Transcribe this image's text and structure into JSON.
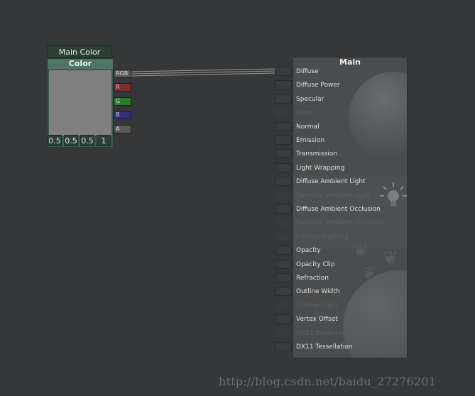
{
  "color_node": {
    "title": "Main Color",
    "header": "Color",
    "swatch_color": "#808080",
    "values": [
      "0.5",
      "0.5",
      "0.5",
      "1"
    ],
    "outputs": [
      {
        "label": "RGB",
        "color": "#5a5a5a"
      },
      {
        "label": "R",
        "color": "#7a2f2f"
      },
      {
        "label": "G",
        "color": "#2f7a32"
      },
      {
        "label": "B",
        "color": "#2f2f7a"
      },
      {
        "label": "A",
        "color": "#5a5a5a"
      }
    ]
  },
  "main_node": {
    "title": "Main",
    "inputs": [
      {
        "label": "Diffuse",
        "enabled": true
      },
      {
        "label": "Diffuse Power",
        "enabled": true
      },
      {
        "label": "Specular",
        "enabled": true
      },
      {
        "label": "Gloss",
        "enabled": false
      },
      {
        "label": "Normal",
        "enabled": true
      },
      {
        "label": "Emission",
        "enabled": true
      },
      {
        "label": "Transmission",
        "enabled": true
      },
      {
        "label": "Light Wrapping",
        "enabled": true
      },
      {
        "label": "Diffuse Ambient Light",
        "enabled": true
      },
      {
        "label": "Specular Ambient Light",
        "enabled": false
      },
      {
        "label": "Diffuse Ambient Occlusion",
        "enabled": true
      },
      {
        "label": "Specular Ambient Occlusion",
        "enabled": false
      },
      {
        "label": "Custom Lighting",
        "enabled": false
      },
      {
        "label": "Opacity",
        "enabled": true
      },
      {
        "label": "Opacity Clip",
        "enabled": true
      },
      {
        "label": "Refraction",
        "enabled": true
      },
      {
        "label": "Outline Width",
        "enabled": true
      },
      {
        "label": "Outline Color",
        "enabled": false
      },
      {
        "label": "Vertex Offset",
        "enabled": true
      },
      {
        "label": "DX11 Displacement",
        "enabled": false
      },
      {
        "label": "DX11 Tessellation",
        "enabled": true
      }
    ]
  },
  "watermark": "http://blog.csdn.net/baidu_27276201"
}
